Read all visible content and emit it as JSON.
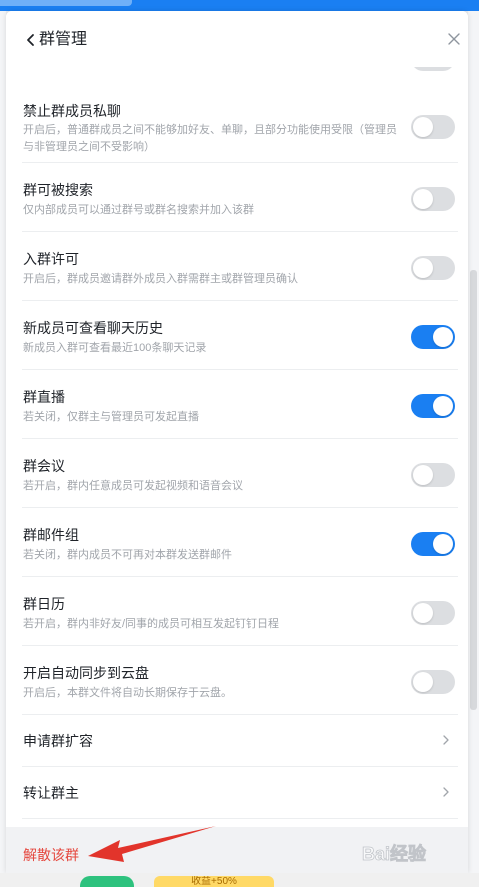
{
  "dialog": {
    "title": "群管理"
  },
  "settings": [
    {
      "title": "禁止群成员私聊",
      "desc": "开启后，普通群成员之间不能够加好友、单聊，且部分功能使用受限（管理员与非管理员之间不受影响）",
      "enabled": false
    },
    {
      "title": "群可被搜索",
      "desc": "仅内部成员可以通过群号或群名搜索并加入该群",
      "enabled": false
    },
    {
      "title": "入群许可",
      "desc": "开启后，群成员邀请群外成员入群需群主或群管理员确认",
      "enabled": false
    },
    {
      "title": "新成员可查看聊天历史",
      "desc": "新成员入群可查看最近100条聊天记录",
      "enabled": true
    },
    {
      "title": "群直播",
      "desc": "若关闭，仅群主与管理员可发起直播",
      "enabled": true
    },
    {
      "title": "群会议",
      "desc": "若开启，群内任意成员可发起视频和语音会议",
      "enabled": false
    },
    {
      "title": "群邮件组",
      "desc": "若关闭，群内成员不可再对本群发送群邮件",
      "enabled": true
    },
    {
      "title": "群日历",
      "desc": "若开启，群内非好友/同事的成员可相互发起钉钉日程",
      "enabled": false
    },
    {
      "title": "开启自动同步到云盘",
      "desc": "开启后，本群文件将自动长期保存于云盘。",
      "enabled": false
    }
  ],
  "links": [
    {
      "label": "申请群扩容"
    },
    {
      "label": "转让群主"
    }
  ],
  "footer": {
    "disband_label": "解散该群"
  },
  "bottom_ad": {
    "text": "收益+50%"
  },
  "watermark": {
    "text": "Bai经验"
  },
  "colors": {
    "accent": "#1a7ff2",
    "danger": "#e5483f",
    "toggle_off": "#dcdee1",
    "annotation_arrow": "#e2342b"
  }
}
